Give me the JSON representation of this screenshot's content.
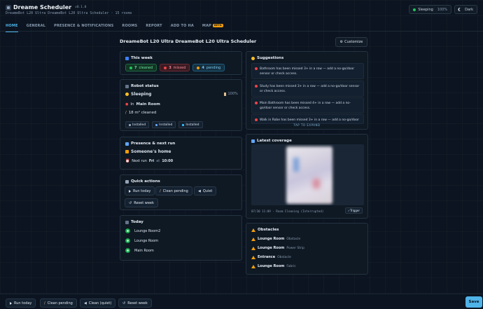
{
  "header": {
    "title": "Dreame Scheduler",
    "version": "v0.1.0",
    "subtitle": "DreameBot L20 Ultra DreameBot L20 Ultra Scheduler · 15 rooms",
    "status_label": "Sleeping",
    "battery": "100%",
    "theme_label": "Dark"
  },
  "tabs": [
    {
      "label": "HOME"
    },
    {
      "label": "GENERAL"
    },
    {
      "label": "PRESENCE & NOTIFICATIONS"
    },
    {
      "label": "ROOMS"
    },
    {
      "label": "REPORT"
    },
    {
      "label": "ADD TO HA"
    },
    {
      "label": "MAP",
      "badge": "BETA"
    }
  ],
  "page": {
    "title": "DreameBot L20 Ultra DreameBot L20 Ultra Scheduler",
    "customize_label": "Customize"
  },
  "this_week": {
    "title": "This week",
    "cleaned_count": "7",
    "cleaned_label": "cleaned",
    "missed_count": "3",
    "missed_label": "missed",
    "pending_count": "4",
    "pending_label": "pending"
  },
  "robot": {
    "title": "Robot status",
    "state": "Sleeping",
    "battery": "100%",
    "location_prefix": "In",
    "location": "Main Room",
    "cleaned_area": "18 m² cleaned",
    "badges": [
      "Installed",
      "Installed",
      "Installed"
    ]
  },
  "presence": {
    "title": "Presence & next run",
    "home_status": "Someone's home",
    "next_run_label": "Next run",
    "next_run_day": "Fri",
    "at_label": "at",
    "next_run_time": "10:00"
  },
  "quick_actions": {
    "title": "Quick actions",
    "run_today": "Run today",
    "clean_pending": "Clean pending",
    "quiet": "Quiet",
    "reset_week": "Reset week"
  },
  "today": {
    "title": "Today",
    "rooms": [
      "Lounge Room2",
      "Lounge Room",
      "Main Room"
    ]
  },
  "suggestions": {
    "title": "Suggestions",
    "items": [
      "Bathroom has been missed 3+ in a row — add a no-go/door sensor or check access.",
      "Study has been missed 3+ in a row — add a no-go/door sensor or check access.",
      "Main Bathroom has been missed 4+ in a row — add a no-go/door sensor or check access.",
      "Walk in Robe has been missed 3+ in a row — add a no-go/door"
    ],
    "expand_label": "TAP TO EXPAND"
  },
  "coverage": {
    "title": "Latest coverage",
    "caption": "07/30 11:09 · Room Cleaning (Interrupted)",
    "trigger_label": "Trigger"
  },
  "obstacles": {
    "title": "Obstacles",
    "items": [
      {
        "room": "Lounge Room",
        "type": "Obstacle"
      },
      {
        "room": "Lounge Room",
        "type": "Power Strip"
      },
      {
        "room": "Entrance",
        "type": "Obstacle"
      },
      {
        "room": "Lounge Room",
        "type": "Fabric"
      }
    ]
  },
  "bottom_bar": {
    "run_today": "Run today",
    "clean_pending": "Clean pending",
    "clean_quiet": "Clean (quiet)",
    "reset_week": "Reset week",
    "save": "Save"
  },
  "colors": {
    "accent": "#4fb3e8",
    "success": "#22c55e",
    "danger": "#ef4444",
    "warning": "#f59e0b",
    "background": "#0b1420"
  }
}
